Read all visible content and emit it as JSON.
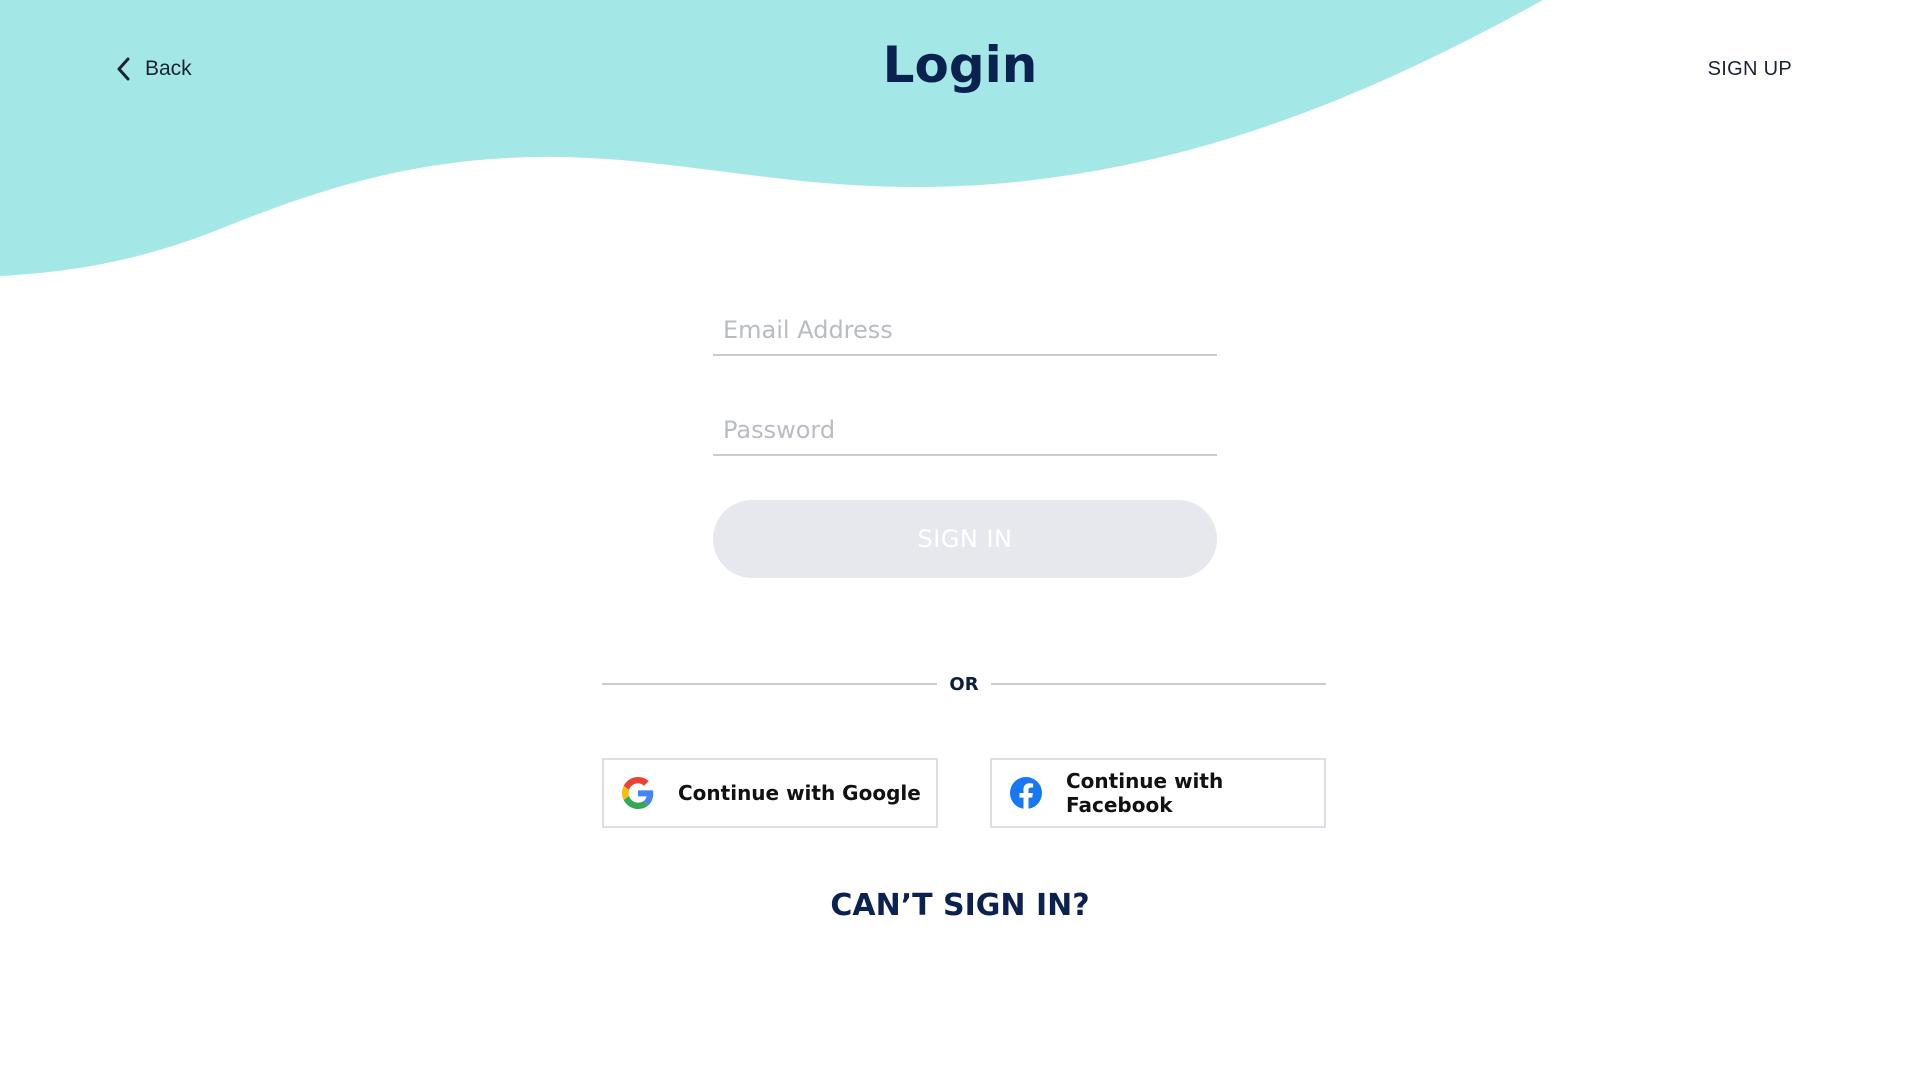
{
  "header": {
    "back_label": "Back",
    "title": "Login",
    "signup_label": "SIGN UP"
  },
  "form": {
    "email_placeholder": "Email Address",
    "email_value": "",
    "password_placeholder": "Password",
    "password_value": "",
    "signin_label": "SIGN IN"
  },
  "divider": {
    "label": "OR"
  },
  "social": {
    "google_label": "Continue with Google",
    "google_icon": "google-icon",
    "facebook_label": "Continue with Facebook",
    "facebook_icon": "facebook-icon"
  },
  "help": {
    "cant_sign_in_label": "CAN’T SIGN IN?"
  },
  "colors": {
    "wave": "#a3e8e6",
    "title": "#0b2250",
    "signin_disabled_bg": "#e6e8ed",
    "facebook_blue": "#1877f2"
  }
}
